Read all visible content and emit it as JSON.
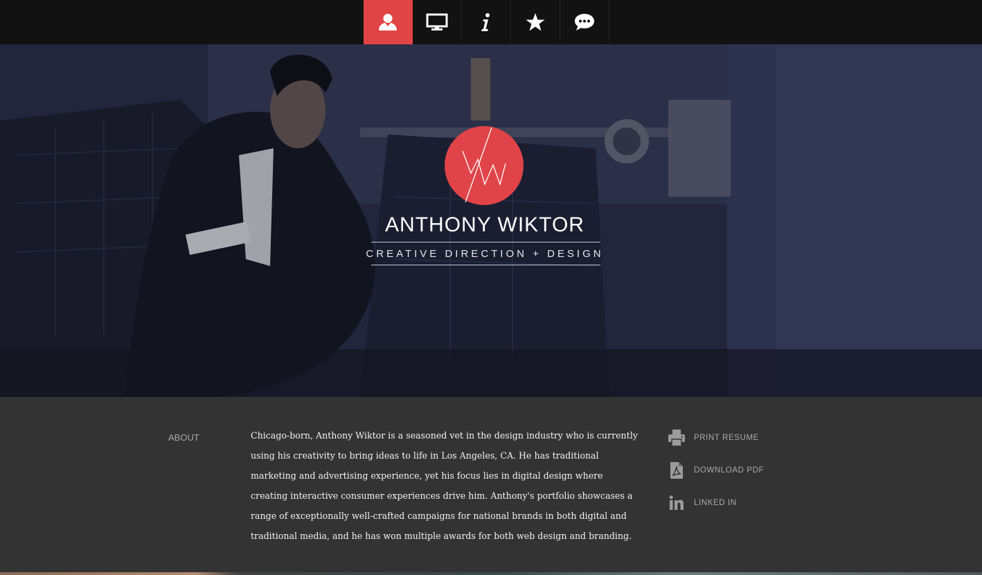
{
  "nav": {
    "items": [
      {
        "icon": "person-icon",
        "active": true
      },
      {
        "icon": "monitor-icon",
        "active": false
      },
      {
        "icon": "info-icon",
        "active": false
      },
      {
        "icon": "star-icon",
        "active": false
      },
      {
        "icon": "chat-bubble-icon",
        "active": false
      }
    ]
  },
  "hero": {
    "logo_icon": "aw-monogram-logo",
    "name": "ANTHONY WIKTOR",
    "tagline": "CREATIVE DIRECTION + DESIGN"
  },
  "about": {
    "label": "ABOUT",
    "body": "Chicago-born, Anthony Wiktor is a seasoned vet in the design industry who is currently using his creativity to bring ideas to life in Los Angeles, CA. He has traditional marketing and advertising experience, yet his focus lies in digital design where creating interactive consumer experiences drive him. Anthony's portfolio showcases a range of exceptionally well-crafted campaigns for national brands in both digital and traditional media, and he has won multiple awards for both web design and branding."
  },
  "links": [
    {
      "label": "PRINT RESUME",
      "icon": "printer-icon"
    },
    {
      "label": "DOWNLOAD PDF",
      "icon": "pdf-icon"
    },
    {
      "label": "LINKED IN",
      "icon": "linkedin-icon"
    }
  ],
  "colors": {
    "accent": "#e04448",
    "topbar": "#121212",
    "content_bg": "#333333"
  }
}
